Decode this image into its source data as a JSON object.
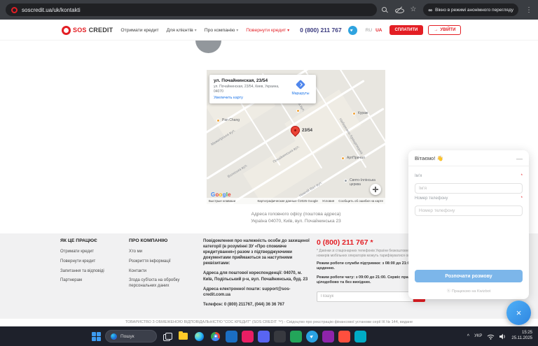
{
  "browser": {
    "url": "soscredit.ua/uk/kontakti",
    "incognito_label": "Вікно в режимі анонімного перегляду"
  },
  "icons": {
    "star": "☆",
    "menu_dots": "⋮",
    "incognito": "∞",
    "caret": "▾",
    "plane": "►",
    "login_arrow": "→",
    "minimize": "—",
    "close": "×",
    "chevron_up": "^",
    "kwizbot": "ⓚ"
  },
  "header": {
    "logo_sos": "SOS",
    "logo_credit": "CREDIT",
    "nav": [
      {
        "label": "Отримати кредит"
      },
      {
        "label": "Для клієнтів"
      },
      {
        "label": "Про компанію"
      },
      {
        "label": "Повернути кредит"
      }
    ],
    "phone": "0 (800) 211 767",
    "lang_ru": "RU",
    "lang_ua": "UA",
    "pay_label": "СПЛАТИТИ",
    "login_label": "УВІЙТИ"
  },
  "map": {
    "card": {
      "title": "ул. Почайнинская, 23/54",
      "address": "ул. Почайнинская, 23/54, Киев, Украина, 04070",
      "enlarge": "Увеличить карту",
      "directions": "Маршруты"
    },
    "marker_label": "23/54",
    "google_letters": [
      "G",
      "o",
      "o",
      "g",
      "l",
      "e"
    ],
    "streets": [
      "Почайнинська вул.",
      "Волоська вул.",
      "Межигірська вул.",
      "Набережно-Хрещатицька",
      "Нижній Вал вул.",
      "Спаська вул."
    ],
    "pois": [
      "Pan Chang",
      "Кураж",
      "АртПричал",
      "Свято-Іллінська церква"
    ],
    "attr_left": "Быстрые клавиши",
    "attr_data": "Картографические данные ©2025 Google",
    "attr_terms": "Условия",
    "attr_report": "Сообщить об ошибке на карте"
  },
  "caption": {
    "line1": "Адреса головного офісу (поштова адреса)",
    "line2": "Україна 04070, Київ, вул. Почайнинська 23"
  },
  "footer": {
    "col1": {
      "title": "ЯК ЦЕ ПРАЦЮЄ",
      "links": [
        "Отримати кредит",
        "Повернути кредит",
        "Запитання та відповіді",
        "Партнерам"
      ]
    },
    "col2": {
      "title": "ПРО КОМПАНІЮ",
      "links": [
        "Хто ми",
        "Розкриття інформації",
        "Контакти",
        "Згода суб'єкта на обробку персональних даних"
      ]
    },
    "col3": {
      "notice": "Повідомлення про належність особи до захищеної категорії (в розумінні ЗУ «Про споживче кредитування») разом з підтверджуючими документами приймаються за наступними реквізитами:",
      "postal": "Адреса для поштової кореспонденції: 04070, м. Київ, Подільський р-н, вул. Почайнинська, буд. 23",
      "email": "Адреса електронної пошти: support@sos-credit.com.ua",
      "phone": "Телефон: 0 (800) 211767, (044) 36 36 767"
    },
    "col4": {
      "phone": "0 (800) 211 767 *",
      "footnote": "* Дзвінки зі стаціонарних телефонів України безкоштовні. Дзвінки з номерів мобільних операторів можуть тарифікуватися оператором",
      "support_hours": "Режим роботи служби підтримки: з 08:00 до 21:00 щоденно.",
      "chat_hours": "Режим роботи чату: з 09:00 до 21:00. Сервіс працює цілодобово та без вихідних.",
      "search_placeholder": "Пошук"
    },
    "legal": "ТОВАРИСТВО З ОБМЕЖЕНОЮ ВІДПОВІДАЛЬНІСТЮ \"СОС КРЕДИТ\" (SOS CREDIT ™) - Свідоцтво про реєстрацію фінансової установи серії ІК № 144, видане"
  },
  "chat": {
    "greeting": "Вітаємо! 👋",
    "required_mark": "*",
    "name_label": "Ім'я",
    "name_placeholder": "Ім'я",
    "phone_label": "Номер телефону",
    "phone_placeholder": "Номер телефону",
    "start_button": "Розпочати розмову",
    "powered_by": "Працюємо на Kwizbot"
  },
  "taskbar": {
    "search_placeholder": "Пошук",
    "lang": "УКР",
    "time": "15:25",
    "date": "25.11.2025"
  }
}
